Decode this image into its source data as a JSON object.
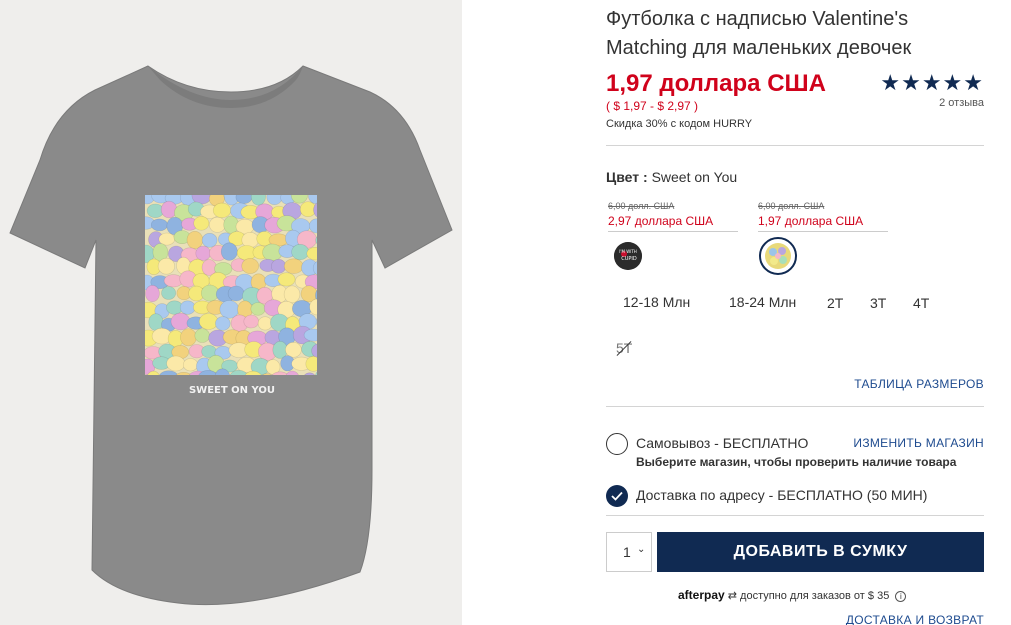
{
  "product": {
    "title": "Футболка с надписью Valentine's Matching для маленьких девочек",
    "price": "1,97 доллара США",
    "price_range": "( $ 1,97 - $ 2,97 )",
    "promo": "Скидка 30% с кодом HURRY",
    "rating_stars": "★★★★★",
    "reviews": "2 отзыва",
    "shirt_print_text": "SWEET ON YOU"
  },
  "color": {
    "label": "Цвет :",
    "value": "Sweet on You",
    "swatches": [
      {
        "old_price": "6,00 долл. США",
        "new_price": "2,97 доллара США",
        "swatch_text": "I'M WITH CUPID",
        "selected": false
      },
      {
        "old_price": "6,00 долл. США",
        "new_price": "1,97 доллара США",
        "selected": true
      }
    ]
  },
  "sizes": {
    "available": [
      "12-18 Млн",
      "18-24 Млн",
      "2T",
      "3T",
      "4T"
    ],
    "unavailable": [
      "5T"
    ],
    "chart_link": "ТАБЛИЦА РАЗМЕРОВ"
  },
  "fulfillment": {
    "pickup_label": "Самовывоз - БЕСПЛАТНО",
    "change_store": "ИЗМЕНИТЬ МАГАЗИН",
    "pickup_sub": "Выберите магазин, чтобы проверить наличие товара",
    "delivery_label": "Доставка по адресу - БЕСПЛАТНО (50 МИН)"
  },
  "cart": {
    "quantity": "1",
    "add_button": "ДОБАВИТЬ В СУМКУ"
  },
  "afterpay": {
    "brand": "afterpay",
    "text": "доступно для заказов от $ 35"
  },
  "footer_link": "ДОСТАВКА И ВОЗВРАТ",
  "colors": {
    "accent_red": "#d0021b",
    "navy": "#102a52",
    "link_blue": "#1e4b8f"
  }
}
